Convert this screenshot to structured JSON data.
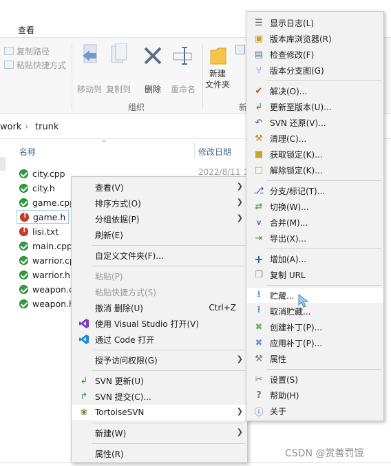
{
  "ribbon": {
    "tab_view": "查看",
    "copy_path": "复制路径",
    "paste_shortcut": "粘贴快捷方式",
    "move_to": "移动到",
    "copy_to": "复制到",
    "delete": "删除",
    "rename": "重命名",
    "new_folder_line1": "新建",
    "new_folder_line2": "文件夹",
    "new_cut": "新",
    "group_organize": "组织"
  },
  "address": {
    "part1": "work",
    "sep": "›",
    "part2": "trunk"
  },
  "list_header": {
    "name": "名称",
    "modified": "修改日期"
  },
  "first_date": "2022/8/11 1",
  "files": [
    {
      "name": "city.cpp",
      "status": "ok"
    },
    {
      "name": "city.h",
      "status": "ok"
    },
    {
      "name": "game.cpp",
      "status": "ok"
    },
    {
      "name": "game.h",
      "status": "modified"
    },
    {
      "name": "lisi.txt",
      "status": "modified"
    },
    {
      "name": "main.cpp",
      "status": "ok"
    },
    {
      "name": "warrior.cpp",
      "status": "ok"
    },
    {
      "name": "warrior.h",
      "status": "ok"
    },
    {
      "name": "weapon.cpp",
      "status": "ok"
    },
    {
      "name": "weapon.h",
      "status": "ok"
    }
  ],
  "context_menu": {
    "view": "查看(V)",
    "sort_by": "排序方式(O)",
    "group_by": "分组依据(P)",
    "refresh": "刷新(E)",
    "customize": "自定义文件夹(F)...",
    "paste": "粘贴(P)",
    "paste_shortcut": "粘贴快捷方式(S)",
    "undo_delete": "撤消 删除(U)",
    "undo_shortcut": "Ctrl+Z",
    "open_vs": "使用 Visual Studio 打开(V)",
    "open_code": "通过 Code 打开",
    "grant_access": "授予访问权限(G)",
    "svn_update": "SVN 更新(U)",
    "svn_commit": "SVN 提交(C)...",
    "tortoise": "TortoiseSVN",
    "new": "新建(W)",
    "properties": "属性(R)"
  },
  "svn_menu": {
    "show_log": "显示日志(L)",
    "repo_browser": "版本库浏览器(R)",
    "check_mod": "检查修改(F)",
    "rev_graph": "版本分支图(G)",
    "resolve": "解决(O)...",
    "update_rev": "更新至版本(U)...",
    "revert": "SVN 还原(V)...",
    "cleanup": "清理(C)...",
    "get_lock": "获取锁定(K)...",
    "release_lock": "解除锁定(K)...",
    "branch_tag": "分支/标记(T)...",
    "switch": "切换(W)...",
    "merge": "合并(M)...",
    "export": "导出(X)...",
    "add": "增加(A)...",
    "copy_url": "复制 URL",
    "shelve": "贮藏...",
    "unshelve": "取消贮藏...",
    "create_patch": "创建补丁(P)...",
    "apply_patch": "应用补丁(P)...",
    "props": "属性",
    "settings": "设置(S)",
    "help": "帮助(H)",
    "about": "关于"
  },
  "watermark": "CSDN @赏善罚饿",
  "colors": {
    "ok": "#2f9e3f",
    "modified": "#d23a2a",
    "menu_bg": "#f2f2f2",
    "highlight": "#ffffff"
  }
}
